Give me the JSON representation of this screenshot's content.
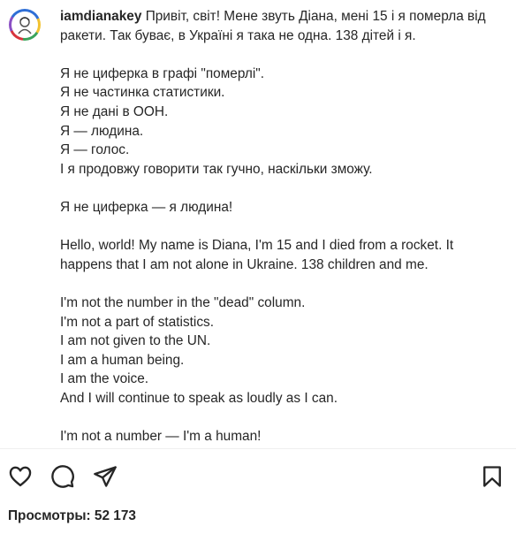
{
  "post": {
    "username": "iamdianakey",
    "avatar_icon": "avatar-illustration-icon",
    "caption_ua": "Привіт, світ! Мене звуть Діана, мені 15 і я померла від ракети. Так буває, в Україні я така не одна. 138 дітей і я.\n\nЯ не циферка в графі \"померлі\".\nЯ не частинка статистики.\nЯ не дані в ООН.\nЯ — людина.\nЯ — голос.\nІ я продовжу говорити так гучно, наскільки зможу.\n\nЯ не циферка — я людина!\n\n",
    "caption_en": "Hello, world! My name is Diana, I'm 15 and I died from a rocket. It happens that I am not alone in Ukraine. 138 children and me.\n\nI'm not the number in the \"dead\" column.\nI'm not a part of statistics.\nI am not given to the UN.\nI am a human being.\nI am the voice.\nAnd I will continue to speak as loudly as I can.\n\nI'm not a number — I'm a human!"
  },
  "actions": {
    "like_icon": "heart-icon",
    "comment_icon": "comment-bubble-icon",
    "share_icon": "paper-plane-icon",
    "save_icon": "bookmark-icon"
  },
  "views_label": "Просмотры: 52 173",
  "colors": {
    "text": "#262626",
    "divider": "#efefef",
    "background": "#ffffff"
  }
}
